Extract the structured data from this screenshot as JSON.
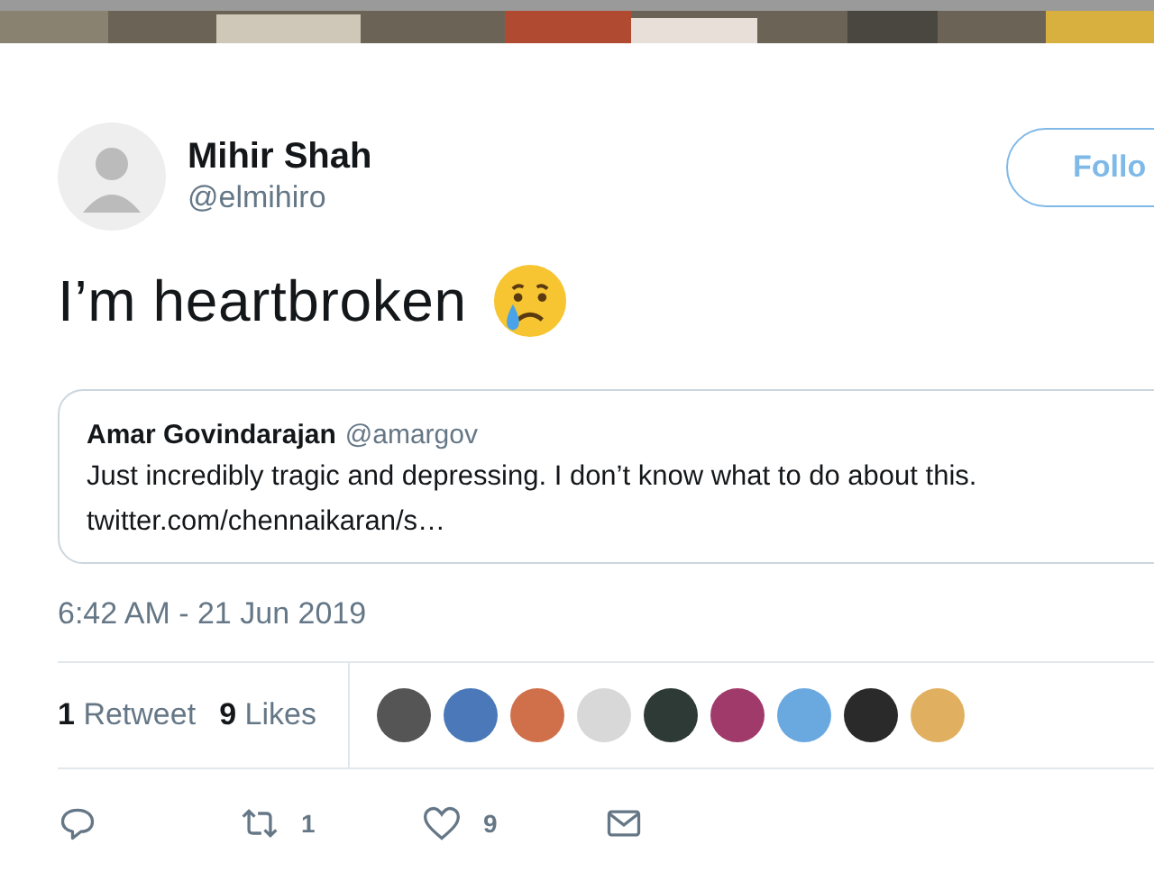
{
  "author": {
    "name": "Mihir Shah",
    "handle": "@elmihiro"
  },
  "follow_button": {
    "label": "Follo"
  },
  "tweet_text": "I’m heartbroken",
  "quoted_tweet": {
    "name": "Amar Govindarajan",
    "handle": "@amargov",
    "text": "Just incredibly tragic and depressing. I don’t know what to do about this.",
    "link": "twitter.com/chennaikaran/s…"
  },
  "timestamp": "6:42 AM - 21 Jun 2019",
  "stats": [
    {
      "count": "1",
      "label": "Retweet"
    },
    {
      "count": "9",
      "label": "Likes"
    }
  ],
  "likers": [
    {
      "color": "#555555"
    },
    {
      "color": "#4a78b8"
    },
    {
      "color": "#d0704a"
    },
    {
      "color": "#d8d8d8"
    },
    {
      "color": "#2e3a35"
    },
    {
      "color": "#a03a6a"
    },
    {
      "color": "#6aa8e0"
    },
    {
      "color": "#2a2a2a"
    },
    {
      "color": "#e0b060"
    }
  ],
  "actions": [
    {
      "kind": "reply"
    },
    {
      "kind": "retweet",
      "count": "1"
    },
    {
      "kind": "like",
      "count": "9"
    },
    {
      "kind": "message"
    }
  ]
}
